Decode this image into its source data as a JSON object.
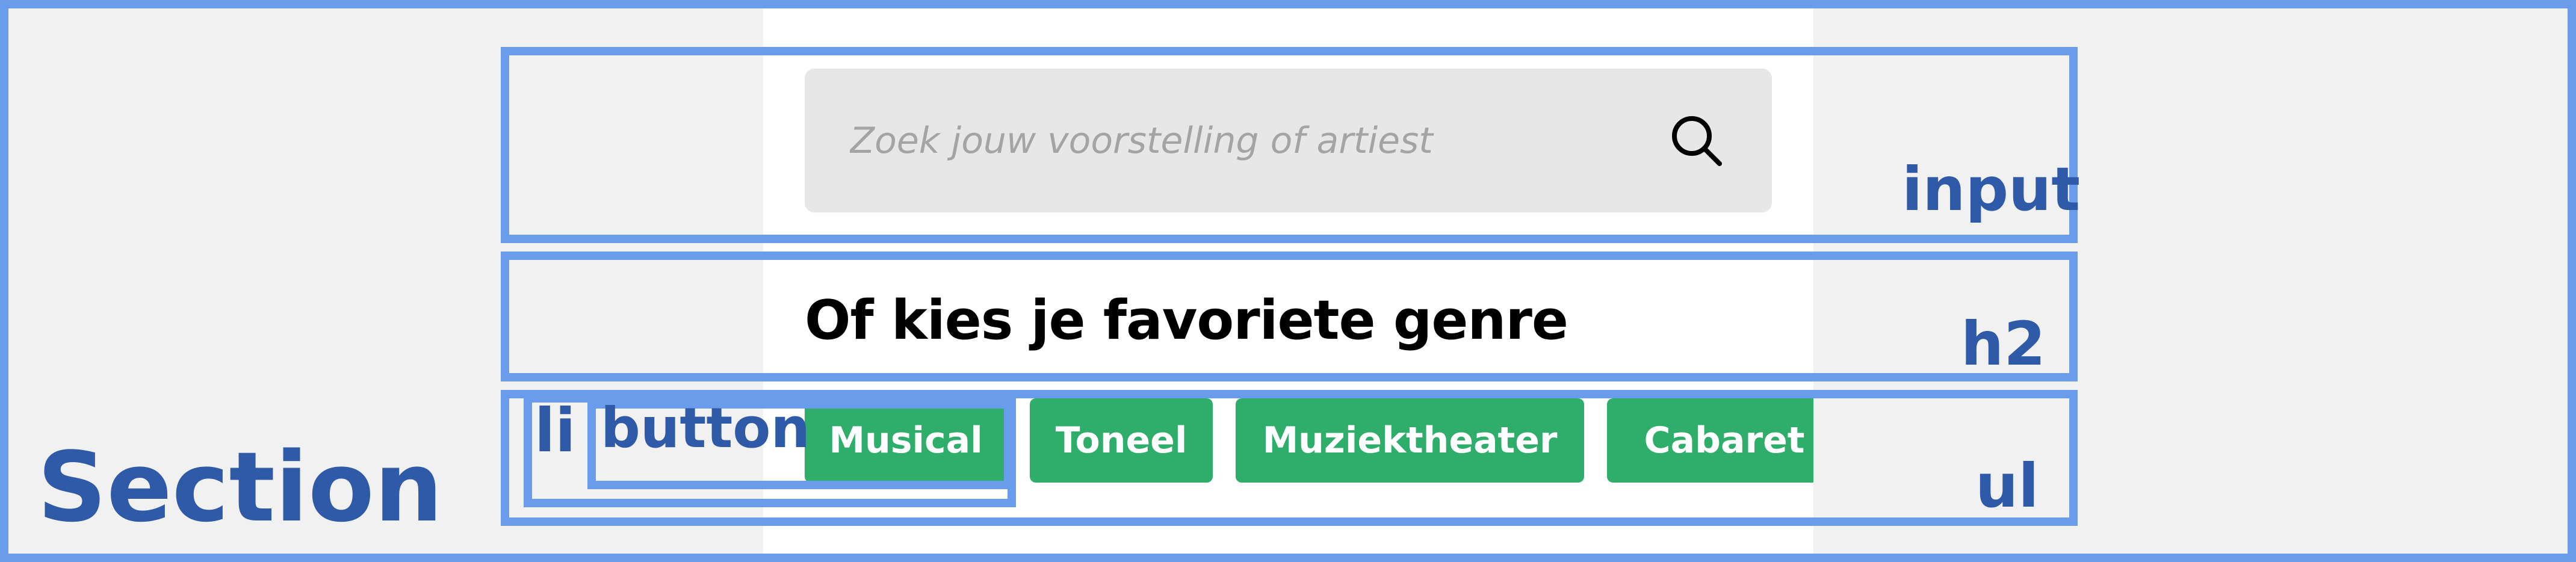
{
  "search": {
    "placeholder": "Zoek jouw voorstelling of artiest",
    "button_icon": "search-icon"
  },
  "heading": "Of kies je favoriete genre",
  "genres": [
    {
      "label": "Musical"
    },
    {
      "label": "Toneel"
    },
    {
      "label": "Muziektheater"
    },
    {
      "label": "Cabaret"
    }
  ],
  "colors": {
    "genre_button_bg": "#2fae6b",
    "annotation_border": "#6a9cec",
    "annotation_text": "#2f5aa7"
  },
  "annotations": {
    "section": "Section",
    "input": "input",
    "h2": "h2",
    "ul": "ul",
    "li": "li",
    "button": "button"
  }
}
